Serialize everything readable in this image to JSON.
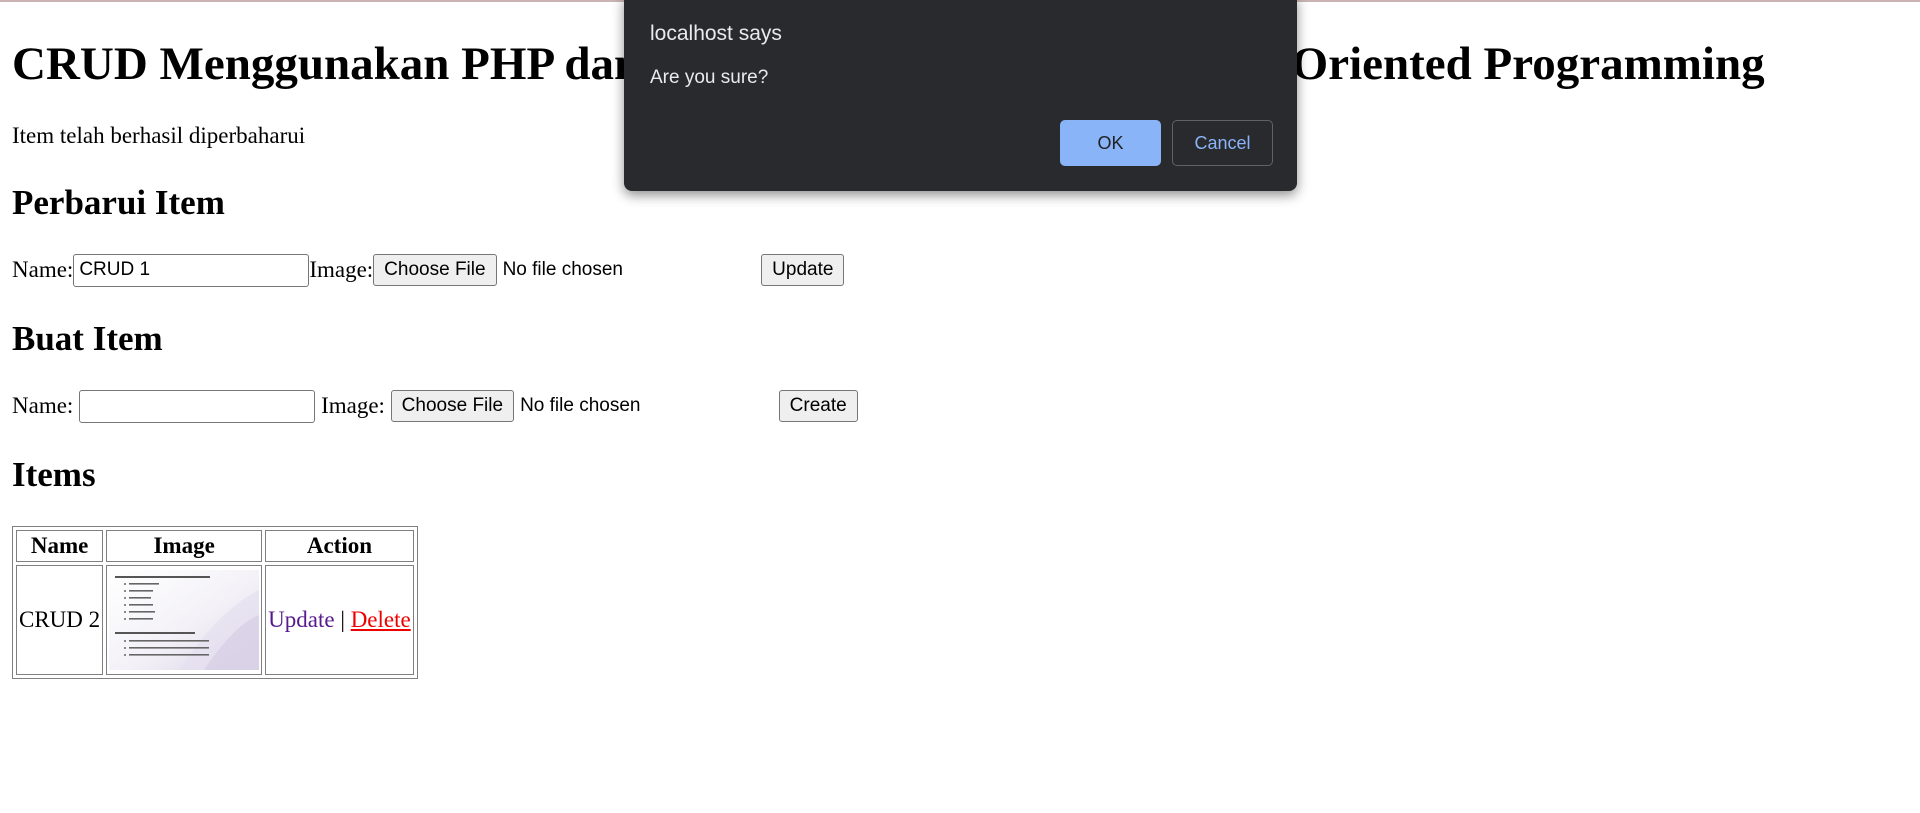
{
  "page": {
    "title": "CRUD Menggunakan PHP dan MySQL dengan Konsep Object Oriented Programming",
    "message": "Item telah berhasil diperbaharui"
  },
  "update_form": {
    "heading": "Perbarui Item",
    "name_label": "Name:",
    "name_value": "CRUD 1",
    "image_label": "Image:",
    "choose_file_label": "Choose File",
    "no_file_text": "No file chosen",
    "submit_label": "Update"
  },
  "create_form": {
    "heading": "Buat Item",
    "name_label": "Name: ",
    "name_value": "",
    "image_label": "Image: ",
    "choose_file_label": "Choose File",
    "no_file_text": "No file chosen",
    "submit_label": "Create"
  },
  "items": {
    "heading": "Items",
    "columns": [
      "Name",
      "Image",
      "Action"
    ],
    "rows": [
      {
        "name": "CRUD 2",
        "image_icon": "document-thumbnail",
        "update_label": "Update",
        "separator": "|",
        "delete_label": "Delete"
      }
    ]
  },
  "dialog": {
    "title": "localhost says",
    "message": "Are you sure?",
    "ok_label": "OK",
    "cancel_label": "Cancel",
    "accent_color": "#8ab4f8",
    "background_color": "#292a2d"
  }
}
